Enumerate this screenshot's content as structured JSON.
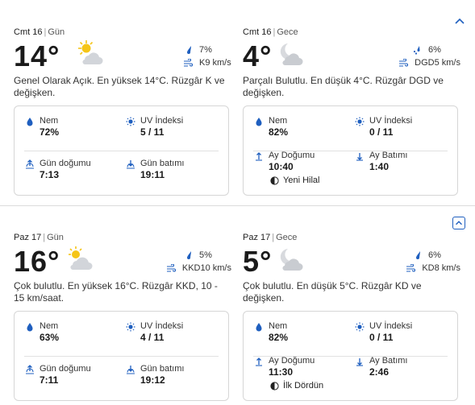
{
  "days": [
    {
      "day": {
        "date": "Cmt 16",
        "part": "Gün",
        "temp": "14°",
        "icon": "sun-cloud-icon",
        "precip": "7%",
        "wind": "K9 km/s",
        "description": "Genel Olarak Açık. En yüksek 14°C. Rüzgâr K ve değişken.",
        "humidity_label": "Nem",
        "humidity": "72%",
        "uv_label": "UV İndeksi",
        "uv": "5 / 11",
        "rise_label": "Gün doğumu",
        "rise": "7:13",
        "set_label": "Gün batımı",
        "set": "19:11"
      },
      "night": {
        "date": "Cmt 16",
        "part": "Gece",
        "temp": "4°",
        "icon": "moon-cloud-icon",
        "precip": "6%",
        "wind": "DGD5 km/s",
        "description": "Parçalı Bulutlu. En düşük 4°C. Rüzgâr DGD ve değişken.",
        "humidity_label": "Nem",
        "humidity": "82%",
        "uv_label": "UV İndeksi",
        "uv": "0 / 11",
        "rise_label": "Ay Doğumu",
        "rise": "10:40",
        "set_label": "Ay Batımı",
        "set": "1:40",
        "moon_phase": "Yeni Hilal"
      }
    },
    {
      "day": {
        "date": "Paz 17",
        "part": "Gün",
        "temp": "16°",
        "icon": "sun-cloud-icon",
        "precip": "5%",
        "wind": "KKD10 km/s",
        "description": "Çok bulutlu. En yüksek 16°C. Rüzgâr KKD, 10 - 15 km/saat.",
        "humidity_label": "Nem",
        "humidity": "63%",
        "uv_label": "UV İndeksi",
        "uv": "4 / 11",
        "rise_label": "Gün doğumu",
        "rise": "7:11",
        "set_label": "Gün batımı",
        "set": "19:12"
      },
      "night": {
        "date": "Paz 17",
        "part": "Gece",
        "temp": "5°",
        "icon": "moon-cloud-icon",
        "precip": "6%",
        "wind": "KD8 km/s",
        "description": "Çok bulutlu. En düşük 5°C. Rüzgâr KD ve değişken.",
        "humidity_label": "Nem",
        "humidity": "82%",
        "uv_label": "UV İndeksi",
        "uv": "0 / 11",
        "rise_label": "Ay Doğumu",
        "rise": "11:30",
        "set_label": "Ay Batımı",
        "set": "2:46",
        "moon_phase": "İlk Dördün"
      }
    }
  ],
  "colors": {
    "accent": "#1f5fbf",
    "border": "#d6d6d6",
    "sun": "#f5c518",
    "cloud": "#c9ccd1"
  }
}
